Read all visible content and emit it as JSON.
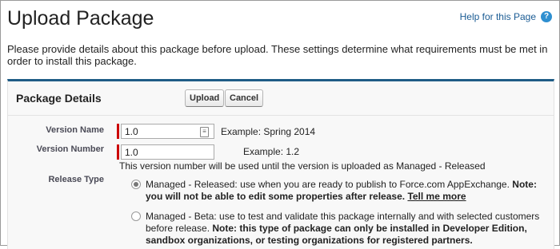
{
  "page": {
    "title": "Upload Package",
    "help_link": "Help for this Page",
    "intro": "Please provide details about this package before upload. These settings determine what requirements must be met in order to install this package."
  },
  "panel": {
    "title": "Package Details",
    "upload_label": "Upload",
    "cancel_label": "Cancel"
  },
  "fields": {
    "version_name": {
      "label": "Version Name",
      "value": "1.0",
      "example": "Example: Spring 2014"
    },
    "version_number": {
      "label": "Version Number",
      "value": "1.0",
      "example": "Example: 1.2",
      "note": "This version number will be used until the version is uploaded as Managed - Released"
    }
  },
  "release_type": {
    "label": "Release Type",
    "options": [
      {
        "checked": true,
        "text": "Managed - Released: use when you are ready to publish to Force.com AppExchange. ",
        "note": "Note: you will not be able to edit some properties after release.",
        "link": "Tell me more"
      },
      {
        "checked": false,
        "text": "Managed - Beta: use to test and validate this package internally and with selected customers before release. ",
        "note": "Note: this type of package can only be installed in Developer Edition, sandbox organizations, or testing organizations for registered partners."
      }
    ]
  },
  "colors": {
    "panel_accent": "#1f5c86",
    "link": "#1b5c94",
    "required": "#cc0000"
  }
}
